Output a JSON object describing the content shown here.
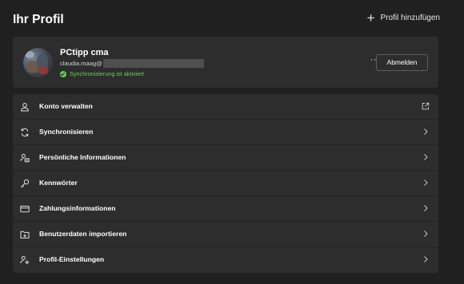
{
  "header": {
    "title": "Ihr Profil",
    "add_profile_label": "Profil hinzufügen"
  },
  "profile": {
    "name": "PCtipp cma",
    "email_visible": "claudia.maag@",
    "sync_status": "Synchronisierung ist aktiviert",
    "more_label": "···",
    "signout_label": "Abmelden"
  },
  "menu": {
    "items": [
      {
        "label": "Konto verwalten",
        "icon": "person-icon",
        "trail": "external-link-icon"
      },
      {
        "label": "Synchronisieren",
        "icon": "sync-icon",
        "trail": "chevron-right-icon"
      },
      {
        "label": "Persönliche Informationen",
        "icon": "person-card-icon",
        "trail": "chevron-right-icon"
      },
      {
        "label": "Kennwörter",
        "icon": "key-icon",
        "trail": "chevron-right-icon"
      },
      {
        "label": "Zahlungsinformationen",
        "icon": "credit-card-icon",
        "trail": "chevron-right-icon"
      },
      {
        "label": "Benutzerdaten importieren",
        "icon": "import-icon",
        "trail": "chevron-right-icon"
      },
      {
        "label": "Profil-Einstellungen",
        "icon": "person-settings-icon",
        "trail": "chevron-right-icon"
      }
    ]
  },
  "colors": {
    "background": "#202020",
    "card": "#2d2d2d",
    "text": "#ffffff",
    "sync_green": "#6ccb5f",
    "border": "#5f5f5f"
  }
}
